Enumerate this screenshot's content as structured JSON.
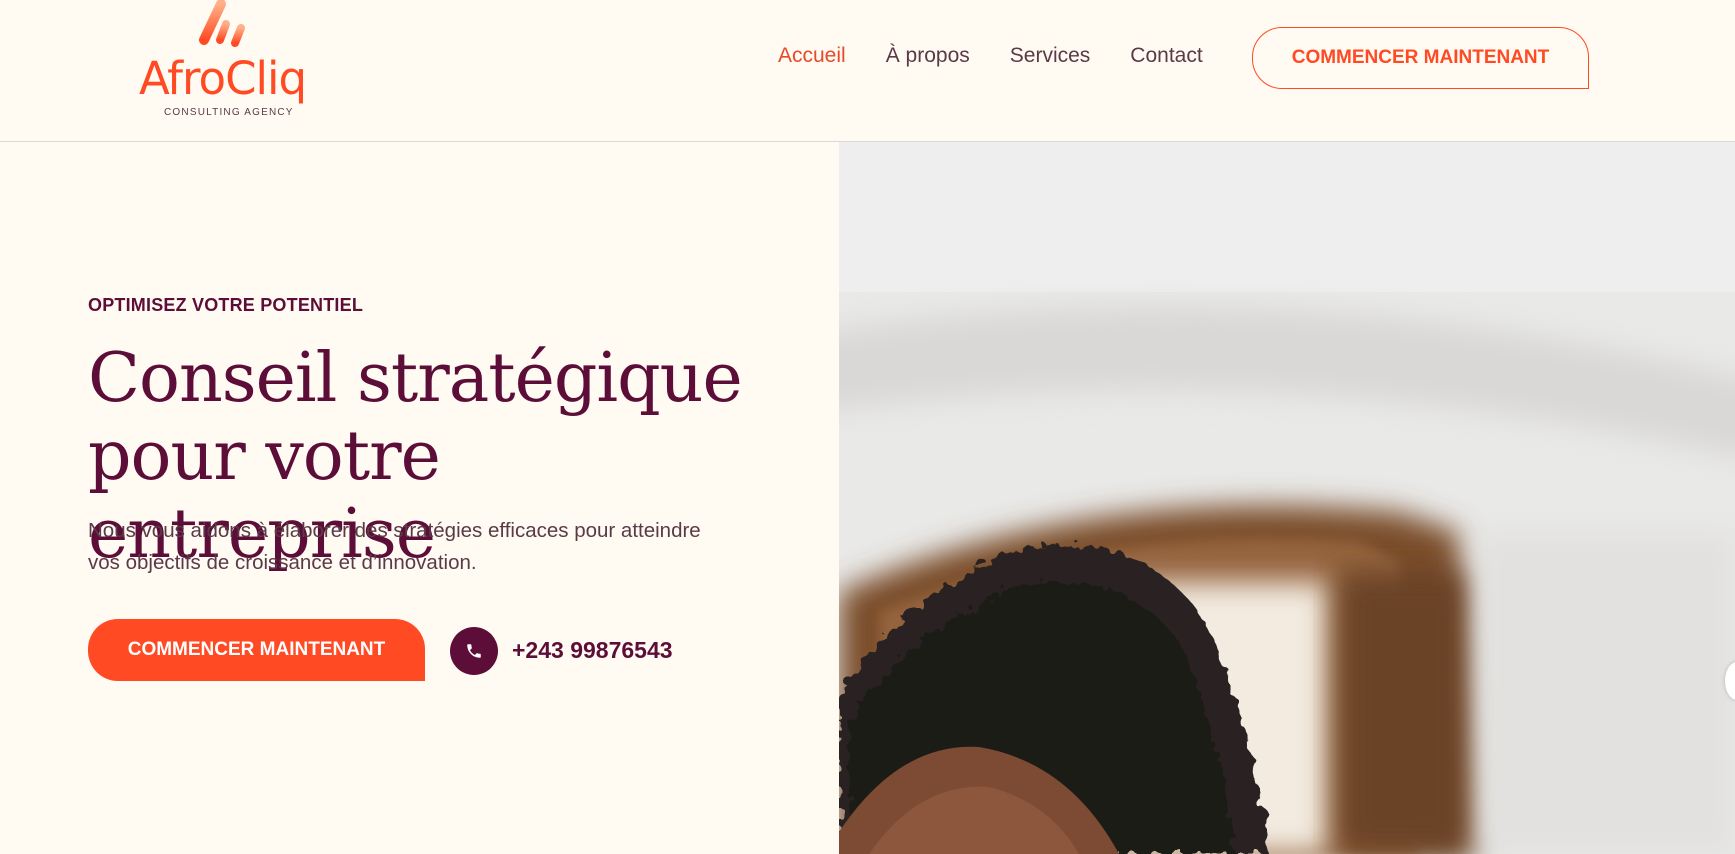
{
  "brand": {
    "name": "AfroCliq",
    "tagline": "CONSULTING AGENCY",
    "accent_color": "#ff4a24",
    "primary_color": "#5c0e38"
  },
  "nav": {
    "items": [
      {
        "label": "Accueil",
        "active": true
      },
      {
        "label": "À propos",
        "active": false
      },
      {
        "label": "Services",
        "active": false
      },
      {
        "label": "Contact",
        "active": false
      }
    ],
    "cta_label": "COMMENCER MAINTENANT"
  },
  "hero": {
    "eyebrow": "OPTIMISEZ VOTRE POTENTIEL",
    "title_line1": "Conseil stratégique",
    "title_line2": "pour votre entreprise",
    "description": "Nous vous aidons à élaborer des stratégies efficaces pour atteindre vos objectifs de croissance et d’innovation.",
    "cta_label": "COMMENCER MAINTENANT",
    "phone_icon": "phone-icon",
    "phone": "+243 99876543"
  }
}
